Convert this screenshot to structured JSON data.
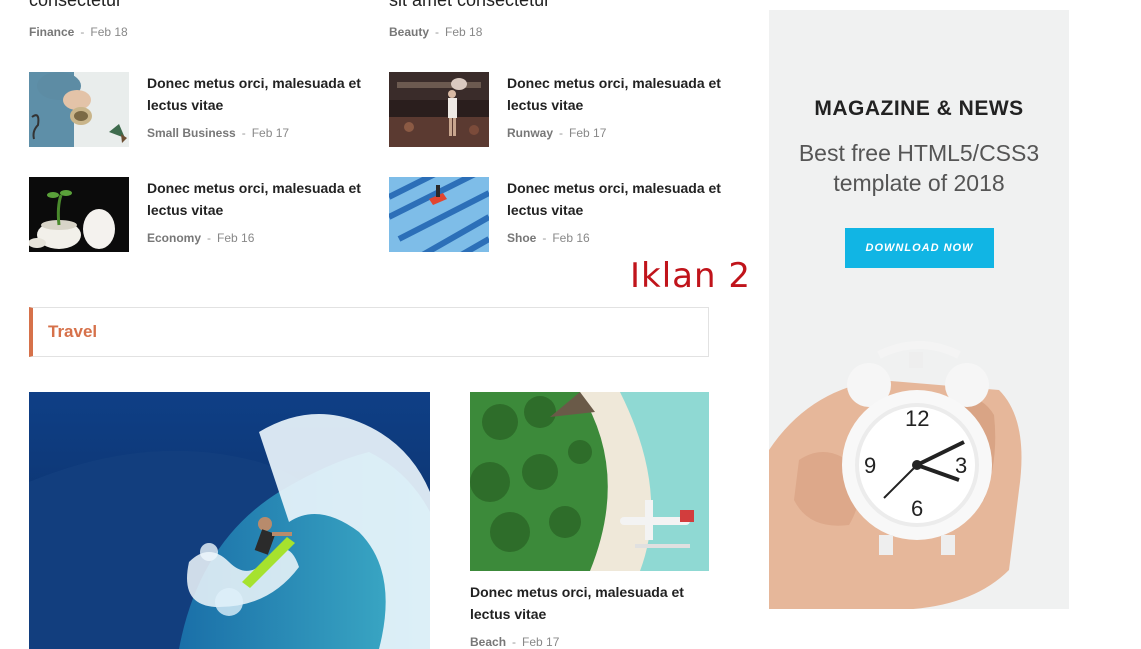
{
  "top_posts": [
    {
      "title": "consectetur",
      "category": "Finance",
      "date": "Feb 18"
    },
    {
      "title": "sit amet consectetur",
      "category": "Beauty",
      "date": "Feb 18"
    }
  ],
  "small_posts": [
    {
      "title": "Donec metus orci, malesuada et lectus vitae",
      "category": "Small Business",
      "date": "Feb 17",
      "icon": "hands-bowl-image"
    },
    {
      "title": "Donec metus orci, malesuada et lectus vitae",
      "category": "Runway",
      "date": "Feb 17",
      "icon": "runway-model-image"
    },
    {
      "title": "Donec metus orci, malesuada et lectus vitae",
      "category": "Economy",
      "date": "Feb 16",
      "icon": "eggs-sprout-image"
    },
    {
      "title": "Donec metus orci, malesuada et lectus vitae",
      "category": "Shoe",
      "date": "Feb 16",
      "icon": "stairs-shoe-image"
    }
  ],
  "meta_separator": "-",
  "iklan_label": "Iklan 2",
  "travel_section": {
    "heading": "Travel",
    "feature": {
      "icon": "surfer-wave-image"
    },
    "side_post": {
      "title": "Donec metus orci, malesuada et lectus vitae",
      "category": "Beach",
      "date": "Feb 17",
      "icon": "beach-seaplane-image"
    }
  },
  "ad": {
    "brand": "MAGAZINE & NEWS",
    "tagline_line1": "Best free HTML5/CSS3",
    "tagline_line2": "template of 2018",
    "button_label": "DOWNLOAD NOW",
    "icon": "alarm-clock-hand-image",
    "colors": {
      "button": "#11b5e4",
      "background": "#f0f1f1"
    }
  },
  "colors": {
    "accent": "#d6714a",
    "iklan": "#c0141b"
  }
}
